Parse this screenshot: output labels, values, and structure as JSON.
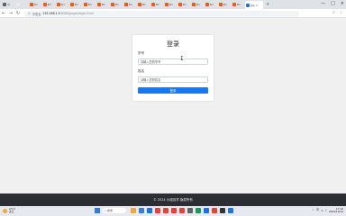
{
  "browser": {
    "tabs": [
      {
        "title": "nd -",
        "color": "#5f6368"
      },
      {
        "title": "",
        "color": "#e8eaed"
      },
      {
        "title": "Bro",
        "color": "#ff5500"
      },
      {
        "title": "Bro",
        "color": "#ff5500"
      },
      {
        "title": "Bro",
        "color": "#ff5500"
      },
      {
        "title": "Bro",
        "color": "#ff5500"
      },
      {
        "title": "Bro",
        "color": "#ff5500"
      },
      {
        "title": "Bro",
        "color": "#ff5500"
      },
      {
        "title": "Bro",
        "color": "#ff5500"
      },
      {
        "title": "Bro",
        "color": "#ff5500"
      },
      {
        "title": "Bro",
        "color": "#ff5500"
      },
      {
        "title": "Bro",
        "color": "#ff5500"
      },
      {
        "title": "Bro",
        "color": "#ff5500"
      },
      {
        "title": "Bro",
        "color": "#ff5500"
      },
      {
        "title": "Bro",
        "color": "#ff5500"
      },
      {
        "title": "Bro",
        "color": "#ff5500"
      },
      {
        "title": "Bro",
        "color": "#ff5500"
      },
      {
        "title": "Bro",
        "color": "#ff5500"
      }
    ],
    "active_tab": {
      "title": "登录",
      "close": "×"
    },
    "new_tab": "+",
    "window_controls": [
      "—",
      "□",
      "×"
    ],
    "security_label": "不安全",
    "url_host": "192.168.1.5",
    "url_path": ":8080/pages/login.html",
    "nav": {
      "back": "←",
      "forward": "→",
      "reload": "↻"
    },
    "toolbar_icons": [
      "☆",
      "⋮"
    ]
  },
  "login": {
    "title": "登录",
    "student_id_label": "学号",
    "student_id_placeholder": "请输入您的学号",
    "name_label": "姓名",
    "name_placeholder": "请输入您的姓名",
    "submit_label": "登录",
    "accent_color": "#1677ff"
  },
  "footer": {
    "text": "© 2024 小组自学 版权所有"
  },
  "taskbar": {
    "weather_temp": "23°C",
    "weather_desc": "多云",
    "search_placeholder": "搜索",
    "apps": [
      "#f2a93b",
      "#3a7bd5",
      "#1a73e8",
      "#e94235",
      "#e94235",
      "#e94235",
      "#e94235",
      "#5f6368",
      "#0f9d58",
      "#1a73e8",
      "#e94235",
      "#333333",
      "#1a73e8"
    ],
    "tray_icons": [
      "^",
      "中",
      "⌂",
      "♪"
    ],
    "time": "17:10",
    "date": "2024/10/12"
  }
}
